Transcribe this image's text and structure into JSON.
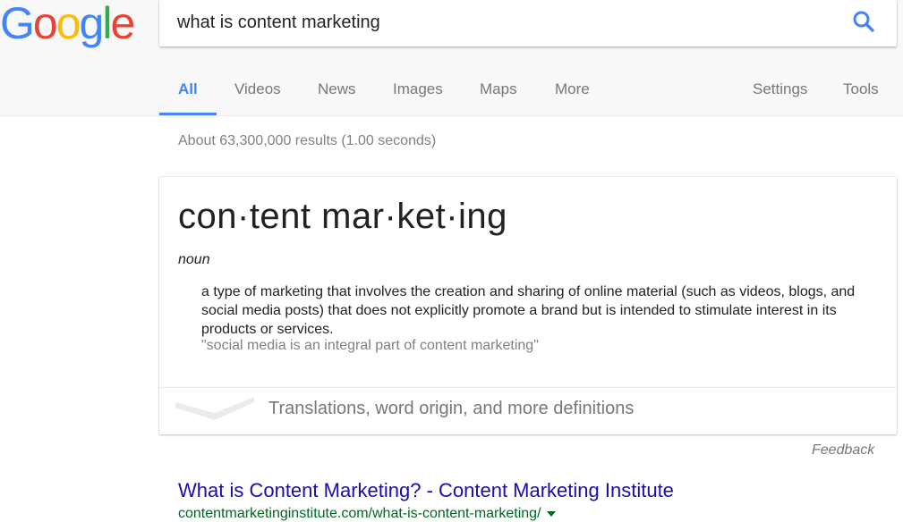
{
  "brand": {
    "logo_letters": [
      "G",
      "o",
      "o",
      "g",
      "l",
      "e"
    ],
    "logo_colors": [
      "#4285f4",
      "#ea4335",
      "#fbbc05",
      "#4285f4",
      "#34a853",
      "#ea4335"
    ]
  },
  "search": {
    "query": "what is content marketing",
    "icon": "search-icon",
    "icon_color": "#4285f4"
  },
  "tabs": {
    "left": [
      {
        "label": "All",
        "active": true
      },
      {
        "label": "Videos"
      },
      {
        "label": "News"
      },
      {
        "label": "Images"
      },
      {
        "label": "Maps"
      },
      {
        "label": "More"
      }
    ],
    "right": [
      {
        "label": "Settings"
      },
      {
        "label": "Tools"
      }
    ]
  },
  "results_count": "About 63,300,000 results (1.00 seconds)",
  "dictionary": {
    "word": "con·tent mar·ket·ing",
    "part_of_speech": "noun",
    "definition": "a type of marketing that involves the creation and sharing of online material (such as videos, blogs, and social media posts) that does not explicitly promote a brand but is intended to stimulate interest in its products or services.",
    "example": "\"social media is an integral part of content marketing\"",
    "more_label": "Translations, word origin, and more definitions",
    "feedback": "Feedback"
  },
  "results": [
    {
      "title": "What is Content Marketing? - Content Marketing Institute",
      "url": "contentmarketinginstitute.com/what-is-content-marketing/"
    }
  ],
  "colors": {
    "accent": "#4285f4",
    "link": "#1a0dab",
    "url": "#006621"
  }
}
